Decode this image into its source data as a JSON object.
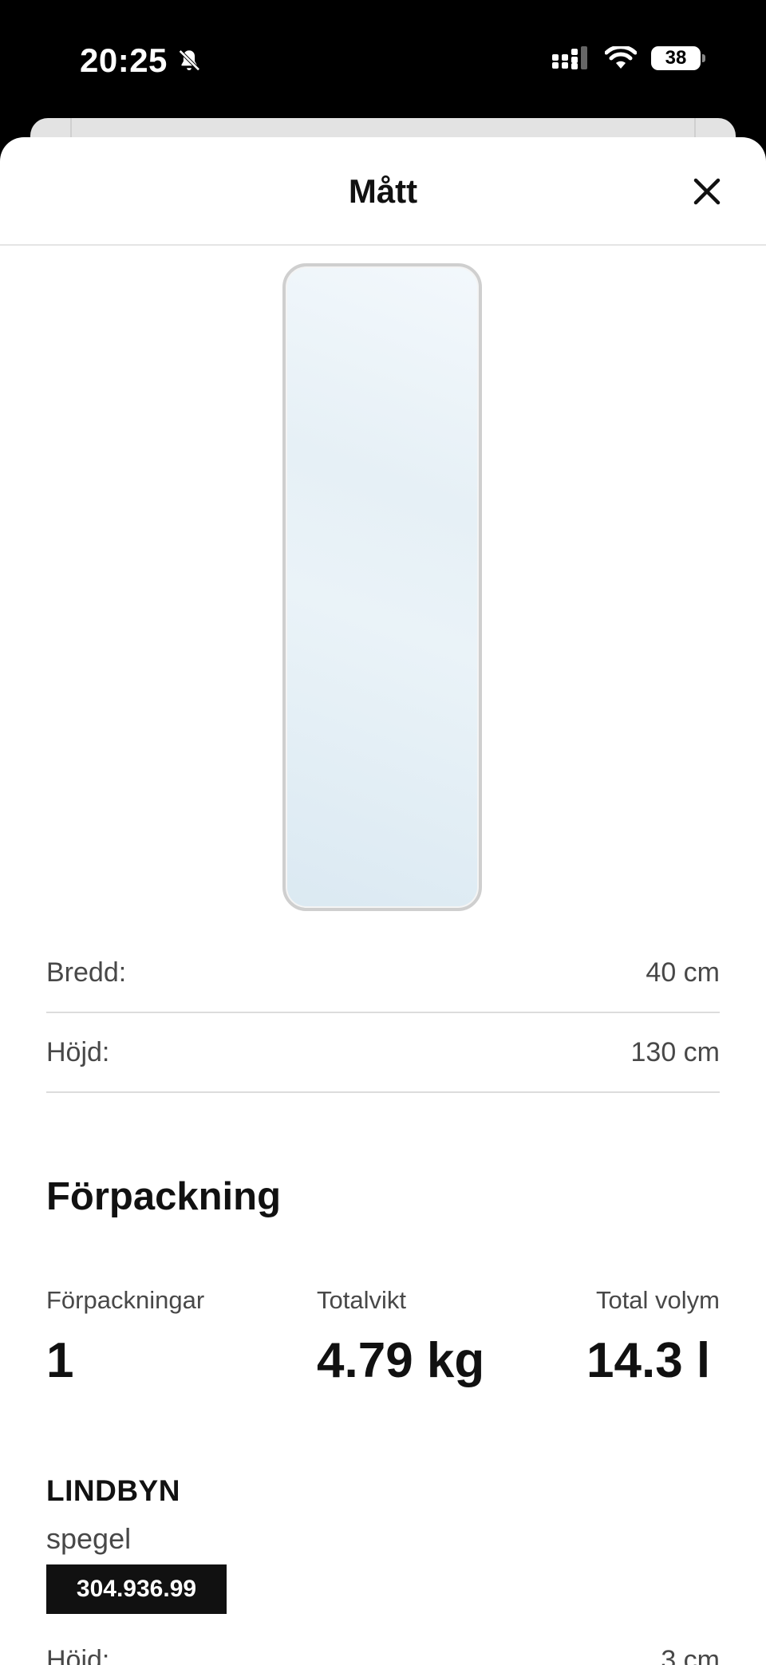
{
  "status_bar": {
    "time": "20:25",
    "battery": "38",
    "icons": [
      "bell-off-icon",
      "signal-icon",
      "wifi-icon",
      "battery-icon"
    ]
  },
  "sheet": {
    "title": "Mått",
    "close_icon": "close-icon"
  },
  "dimensions": [
    {
      "label": "Bredd:",
      "value": "40 cm"
    },
    {
      "label": "Höjd:",
      "value": "130 cm"
    }
  ],
  "packaging": {
    "title": "Förpackning",
    "stats": [
      {
        "label": "Förpackningar",
        "value": "1"
      },
      {
        "label": "Totalvikt",
        "value": "4.79 kg"
      },
      {
        "label": "Total volym",
        "value": "14.3 l"
      }
    ]
  },
  "product": {
    "name": "LINDBYN",
    "type": "spegel",
    "article_number": "304.936.99",
    "partial_row": {
      "label": "Höjd:",
      "value": "3 cm"
    }
  }
}
